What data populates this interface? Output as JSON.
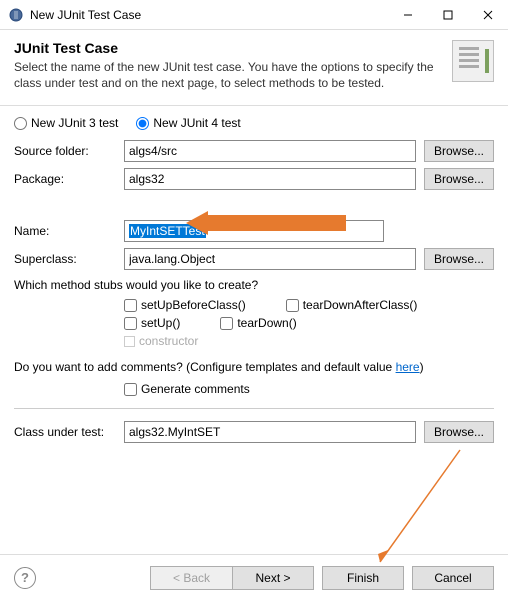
{
  "titlebar": {
    "title": "New JUnit Test Case"
  },
  "header": {
    "title": "JUnit Test Case",
    "description": "Select the name of the new JUnit test case. You have the options to specify the class under test and on the next page, to select methods to be tested."
  },
  "radios": {
    "junit3": "New JUnit 3 test",
    "junit4": "New JUnit 4 test"
  },
  "fields": {
    "source_label": "Source folder:",
    "source_value": "algs4/src",
    "package_label": "Package:",
    "package_value": "algs32",
    "name_label": "Name:",
    "name_value": "MyIntSETTest",
    "super_label": "Superclass:",
    "super_value": "java.lang.Object",
    "class_label": "Class under test:",
    "class_value": "algs32.MyIntSET"
  },
  "browse": "Browse...",
  "stubs": {
    "question": "Which method stubs would you like to create?",
    "setupbefore": "setUpBeforeClass()",
    "teardownafter": "tearDownAfterClass()",
    "setup": "setUp()",
    "teardown": "tearDown()",
    "constructor": "constructor"
  },
  "comments": {
    "question_before": "Do you want to add comments? (Configure templates and default value ",
    "here": "here",
    "question_after": ")",
    "generate": "Generate comments"
  },
  "buttons": {
    "back": "< Back",
    "next": "Next >",
    "finish": "Finish",
    "cancel": "Cancel"
  }
}
